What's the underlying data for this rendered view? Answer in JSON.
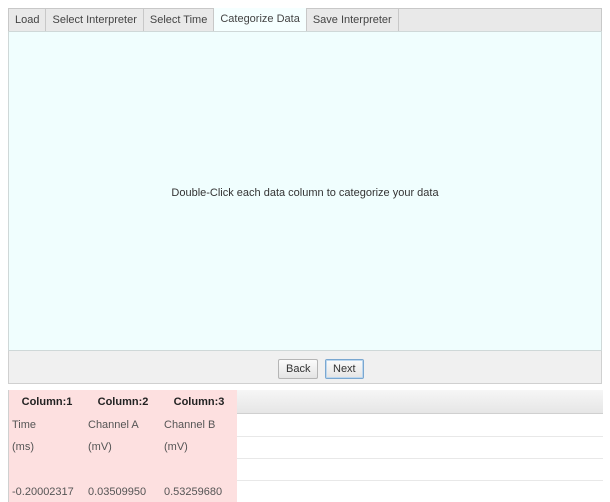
{
  "tabs": [
    {
      "label": "Load"
    },
    {
      "label": "Select Interpreter"
    },
    {
      "label": "Select Time"
    },
    {
      "label": "Categorize Data",
      "active": true
    },
    {
      "label": "Save Interpreter"
    }
  ],
  "panel": {
    "instruction": "Double-Click each data column to categorize your data"
  },
  "buttons": {
    "back": "Back",
    "next": "Next"
  },
  "grid": {
    "columns": [
      "Column:1",
      "Column:2",
      "Column:3"
    ],
    "rows": [
      [
        "Time",
        "Channel A",
        "Channel B"
      ],
      [
        "(ms)",
        "(mV)",
        "(mV)"
      ],
      [
        "",
        "",
        ""
      ],
      [
        "-0.20002317",
        "0.03509950",
        "0.53259680"
      ]
    ]
  },
  "colors": {
    "panel_bg": "#f0fefe",
    "selected_column_bg": "#fde0e0"
  }
}
